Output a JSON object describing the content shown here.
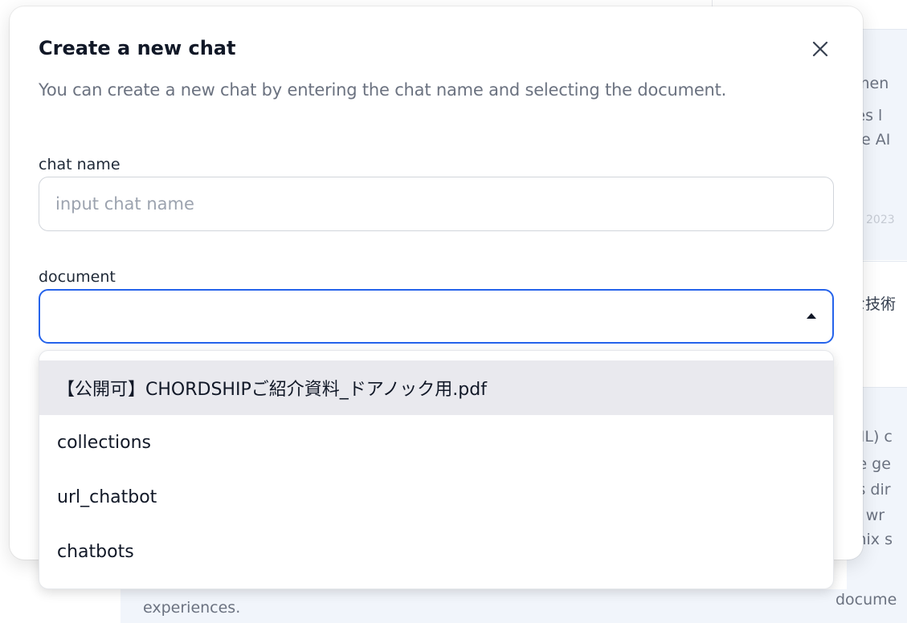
{
  "modal": {
    "title": "Create a new chat",
    "subtitle": "You can create a new chat by entering the chat name and selecting the document.",
    "close_icon": "close-icon",
    "chat_name_label": "chat name",
    "chat_name_placeholder": "input chat name",
    "chat_name_value": "",
    "document_label": "document",
    "document_selected": "",
    "dropdown_arrow_icon": "caret-up-icon"
  },
  "dropdown": {
    "options": [
      "【公開可】CHORDSHIPご紹介資料_ドアノック用.pdf",
      "collections",
      "url_chatbot",
      "chatbots"
    ],
    "highlighted_index": 0
  },
  "background": {
    "card1_lines": [
      "men",
      "res l",
      "ne AI"
    ],
    "card1_date": "2023",
    "card2_text": "な技術",
    "card3_lines": [
      "ML) c",
      "te ge",
      "ts dir",
      "e wr",
      "mix s"
    ],
    "bottom_right_text": "docume",
    "bottom_text": "experiences."
  },
  "colors": {
    "accent": "#2563eb",
    "title": "#111827",
    "muted": "#6b7280",
    "highlight": "#e9e9ee"
  }
}
